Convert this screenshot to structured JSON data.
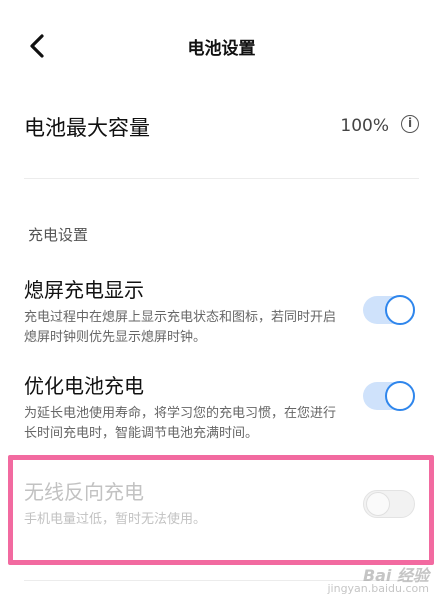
{
  "header": {
    "title": "电池设置"
  },
  "capacity": {
    "label": "电池最大容量",
    "value": "100%"
  },
  "section": {
    "title": "充电设置"
  },
  "settings": [
    {
      "title": "熄屏充电显示",
      "desc": "充电过程中在熄屏上显示充电状态和图标，若同时开启熄屏时钟则优先显示熄屏时钟。",
      "on": true
    },
    {
      "title": "优化电池充电",
      "desc": "为延长电池使用寿命，将学习您的充电习惯，在您进行长时间充电时，智能调节电池充满时间。",
      "on": true
    },
    {
      "title": "无线反向充电",
      "desc": "手机电量过低，暂时无法使用。",
      "on": false,
      "disabled": true
    }
  ],
  "colors": {
    "accent": "#2f86ec",
    "highlight": "#f26aa0"
  },
  "watermark": {
    "text": "Bai 经验",
    "sub": "jingyan.baidu.com"
  }
}
